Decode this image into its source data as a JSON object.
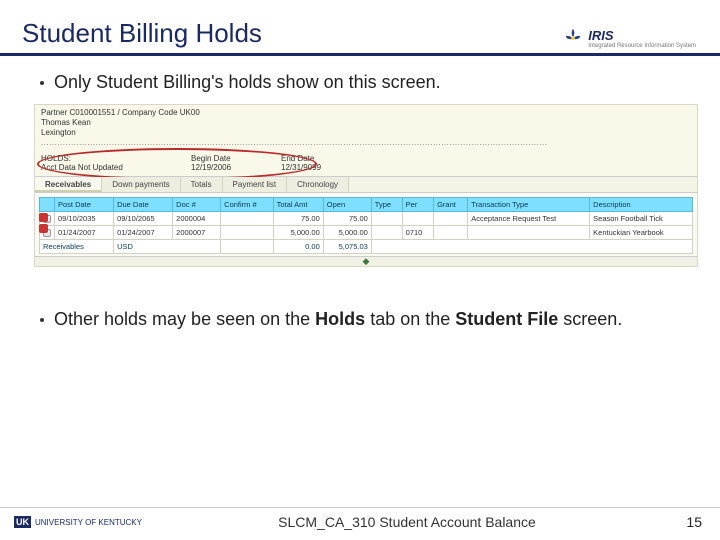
{
  "header": {
    "title": "Student Billing Holds",
    "logo": {
      "name": "IRIS",
      "tagline": "Integrated Resource Information System"
    }
  },
  "bullets": {
    "first": "Only Student Billing's holds show on this screen.",
    "second_pre": "Other holds may be seen on the ",
    "second_b1": "Holds",
    "second_mid": " tab on the ",
    "second_b2": "Student File",
    "second_post": " screen."
  },
  "sap": {
    "partner_line": "Partner C010001551 / Company Code UK00",
    "name": "Thomas Kean",
    "city": "Lexington",
    "holds": {
      "label": "HOLDS:",
      "col_begin": "Begin Date",
      "col_end": "End Date",
      "row_label": "Acct Data Not Updated",
      "begin": "12/19/2006",
      "end": "12/31/9099"
    },
    "tabs": [
      "Receivables",
      "Down payments",
      "Totals",
      "Payment list",
      "Chronology"
    ],
    "columns": [
      "",
      "Post Date",
      "Due Date",
      "Doc #",
      "Confirm #",
      "Total Amt",
      "Open",
      "Type",
      "Per",
      "Grant",
      "Transaction Type",
      "Description"
    ],
    "rows": [
      {
        "post": "09/10/2035",
        "due": "09/10/2065",
        "doc": "2000004",
        "confirm": "",
        "total": "75.00",
        "open": "75.00",
        "type": "",
        "per": "",
        "grant": "",
        "ttype": "Acceptance Request Test",
        "desc": "Season Football Tick"
      },
      {
        "post": "01/24/2007",
        "due": "01/24/2007",
        "doc": "2000007",
        "confirm": "",
        "total": "5,000.00",
        "open": "5,000.00",
        "type": "",
        "per": "0710",
        "grant": "",
        "ttype": "",
        "desc": "Kentuckian Yearbook"
      }
    ],
    "total_row": {
      "label": "Receivables",
      "curr": "USD",
      "total": "0.00",
      "open": "5,075.03"
    }
  },
  "footer": {
    "uk": "UNIVERSITY OF KENTUCKY",
    "center": "SLCM_CA_310 Student Account Balance",
    "page": "15"
  }
}
